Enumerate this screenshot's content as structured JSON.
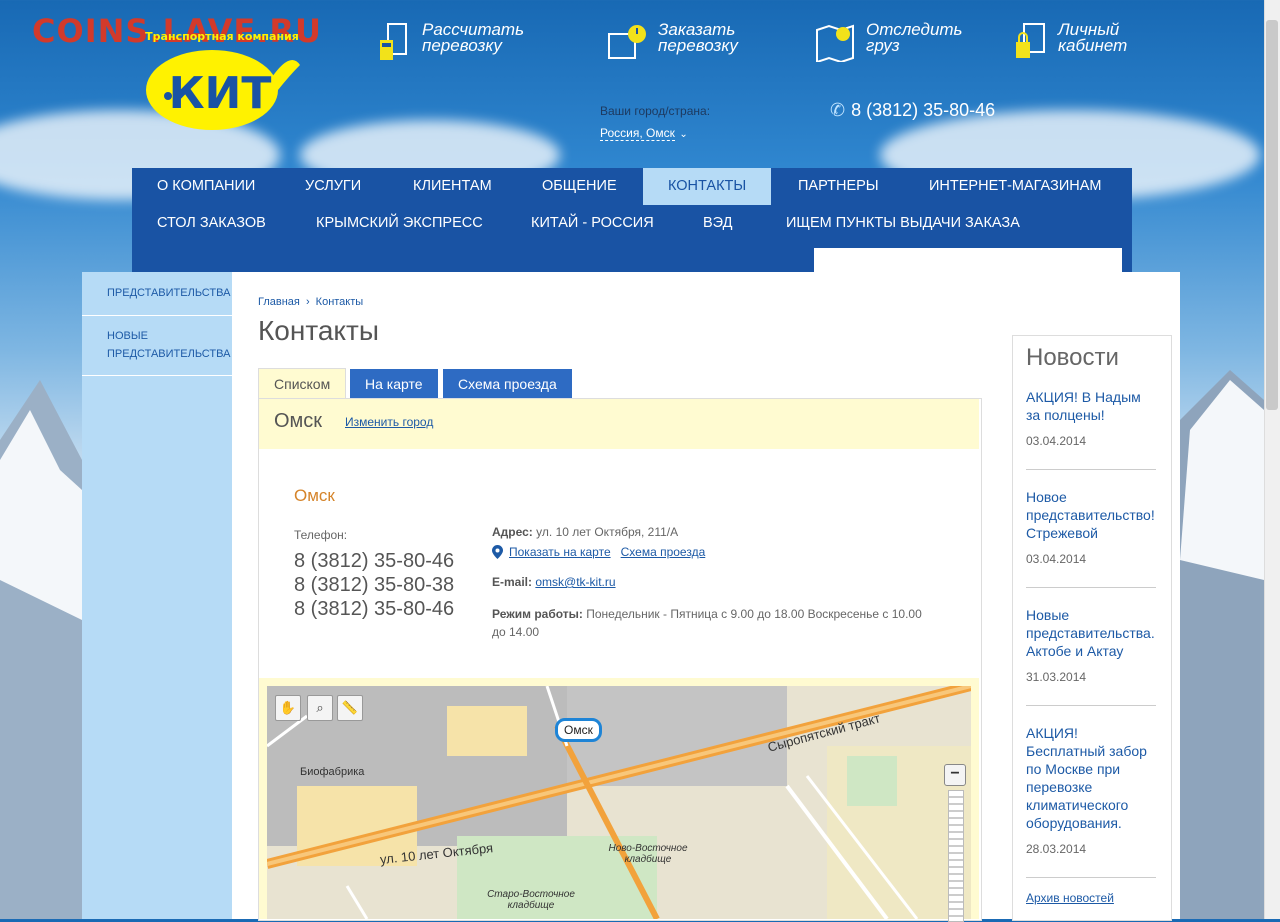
{
  "watermark": "COINS.LAVE.RU",
  "logo": {
    "arc_text": "Транспортная компания",
    "mark": "КИТ"
  },
  "header_links": [
    {
      "label_line1": "Рассчитать",
      "label_line2": "перевозку",
      "icon": "calculator-icon"
    },
    {
      "label_line1": "Заказать",
      "label_line2": "перевозку",
      "icon": "clock-order-icon"
    },
    {
      "label_line1": "Отследить",
      "label_line2": "груз",
      "icon": "map-track-icon"
    },
    {
      "label_line1": "Личный",
      "label_line2": "кабинет",
      "icon": "lock-icon"
    }
  ],
  "city_selector": {
    "label": "Ваши город/страна:",
    "value": "Россия, Омск"
  },
  "phone": "8 (3812) 35-80-46",
  "nav": {
    "row1": [
      "О КОМПАНИИ",
      "УСЛУГИ",
      "КЛИЕНТАМ",
      "ОБЩЕНИЕ",
      "КОНТАКТЫ",
      "ПАРТНЕРЫ",
      "ИНТЕРНЕТ-МАГАЗИНАМ"
    ],
    "row2": [
      "СТОЛ ЗАКАЗОВ",
      "КРЫМСКИЙ ЭКСПРЕСС",
      "КИТАЙ - РОССИЯ",
      "ВЭД",
      "ИЩЕМ ПУНКТЫ ВЫДАЧИ ЗАКАЗА"
    ],
    "active": "КОНТАКТЫ"
  },
  "sidebar": {
    "items": [
      "ПРЕДСТАВИТЕЛЬСТВА",
      "НОВЫЕ ПРЕДСТАВИТЕЛЬСТВА"
    ]
  },
  "breadcrumb": {
    "home": "Главная",
    "separator": "›",
    "current": "Контакты"
  },
  "page_title": "Контакты",
  "tabs": [
    "Списком",
    "На карте",
    "Схема проезда"
  ],
  "city_bar": {
    "title": "Омск",
    "change_link": "Изменить город"
  },
  "office": {
    "name": "Омск",
    "phone_label": "Телефон:",
    "phones": [
      "8 (3812) 35-80-46",
      "8 (3812) 35-80-38",
      "8 (3812) 35-80-46"
    ],
    "address_label": "Адрес:",
    "address": "ул. 10 лет Октября, 211/А",
    "show_on_map": "Показать на карте",
    "route_scheme": "Схема проезда",
    "email_label": "E-mail:",
    "email": "omsk@tk-kit.ru",
    "hours_label": "Режим работы:",
    "hours": "Понедельник - Пятница с 9.00 до 18.00 Воскресенье с 10.00 до 14.00"
  },
  "map": {
    "pin": "Омск",
    "labels": [
      "Биофабрика",
      "Сыропятский тракт",
      "ул. 10 лет Октября",
      "Ново-Восточное кладбище",
      "Старо-Восточное кладбище"
    ],
    "zoom_minus": "−"
  },
  "news": {
    "title": "Новости",
    "items": [
      {
        "text": "АКЦИЯ! В Надым за полцены!",
        "date": "03.04.2014"
      },
      {
        "text": "Новое представительство! Стрежевой",
        "date": "03.04.2014"
      },
      {
        "text": "Новые представительства. Актобе и Актау",
        "date": "31.03.2014"
      },
      {
        "text": "АКЦИЯ! Бесплатный забор по Москве при перевозке климатического оборудования.",
        "date": "28.03.2014"
      }
    ],
    "archive": "Архив новостей"
  }
}
